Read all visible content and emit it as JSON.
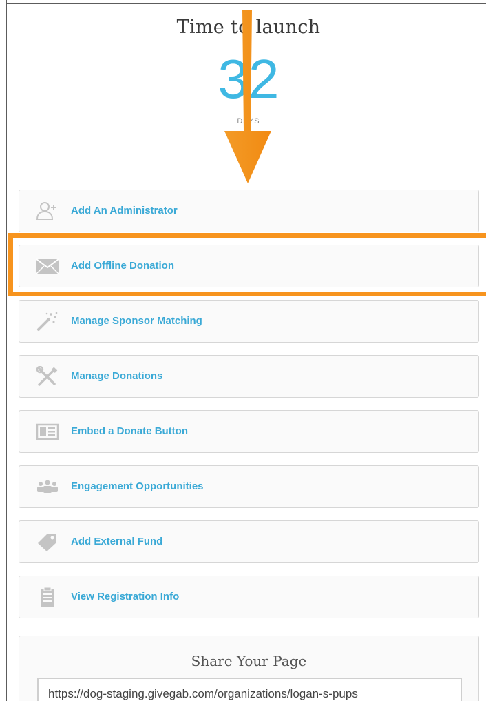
{
  "countdown": {
    "title": "Time to launch",
    "value": "32",
    "unit": "DAYS"
  },
  "actions": [
    {
      "label": "Add An Administrator",
      "icon": "add-user-icon"
    },
    {
      "label": "Add Offline Donation",
      "icon": "envelope-icon"
    },
    {
      "label": "Manage Sponsor Matching",
      "icon": "magic-wand-icon"
    },
    {
      "label": "Manage Donations",
      "icon": "tools-icon"
    },
    {
      "label": "Embed a Donate Button",
      "icon": "embed-icon"
    },
    {
      "label": "Engagement Opportunities",
      "icon": "group-icon"
    },
    {
      "label": "Add External Fund",
      "icon": "tag-icon"
    },
    {
      "label": "View Registration Info",
      "icon": "clipboard-icon"
    }
  ],
  "share": {
    "title": "Share Your Page",
    "url": "https://dog-staging.givegab.com/organizations/logan-s-pups"
  },
  "colors": {
    "accent": "#3aa9d6",
    "count": "#3fb8e3",
    "highlight": "#f7941e",
    "icon": "#c4c4c4"
  }
}
